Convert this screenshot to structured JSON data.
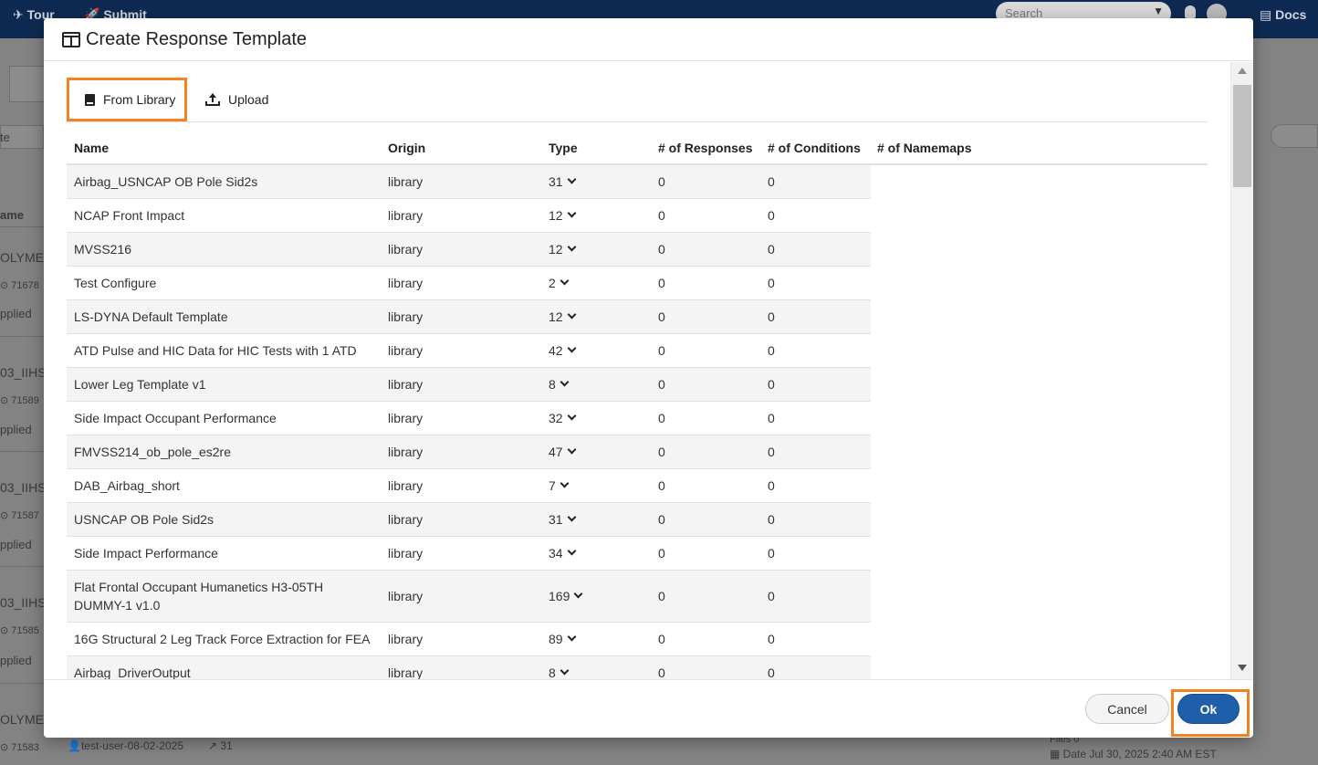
{
  "background": {
    "nav": [
      {
        "label": "Tour"
      },
      {
        "label": "Submit"
      }
    ],
    "search_placeholder": "Search",
    "docs_label": "Docs",
    "left_fragments": {
      "name_header": "ame",
      "row_a_title": "OLYME",
      "row_a_id": "71678",
      "row_a_status": "pplied",
      "row_b_title": "03_IIHS",
      "row_b_id": "71589",
      "row_b_status": "pplied",
      "row_c_title": "03_IIHS",
      "row_c_id": "71587",
      "row_c_status": "pplied",
      "row_d_title": "03_IIHS",
      "row_d_id": "71585",
      "row_d_status": "pplied",
      "row_e_title": "OLYME",
      "row_e_id": "71583",
      "row_e_user": "test-user-08-02-2025",
      "row_e_count": "31",
      "filter_fragment": "te"
    },
    "right_fragments": {
      "files": "Files 0",
      "date": "Date Jul 30, 2025 2:40 AM EST"
    }
  },
  "modal": {
    "title": "Create Response Template",
    "tabs": [
      {
        "label": "From Library",
        "icon": "book-icon",
        "active": true
      },
      {
        "label": "Upload",
        "icon": "upload-icon",
        "active": false
      }
    ],
    "columns": [
      "Name",
      "Origin",
      "Type",
      "# of Responses",
      "# of Conditions",
      "# of Namemaps"
    ],
    "rows": [
      {
        "name": "Airbag_USNCAP OB Pole Sid2s",
        "origin": "library",
        "type": "31",
        "responses": "0",
        "conditions": "0"
      },
      {
        "name": "NCAP Front Impact",
        "origin": "library",
        "type": "12",
        "responses": "0",
        "conditions": "0"
      },
      {
        "name": "MVSS216",
        "origin": "library",
        "type": "12",
        "responses": "0",
        "conditions": "0"
      },
      {
        "name": "Test Configure",
        "origin": "library",
        "type": "2",
        "responses": "0",
        "conditions": "0"
      },
      {
        "name": "LS-DYNA Default Template",
        "origin": "library",
        "type": "12",
        "responses": "0",
        "conditions": "0"
      },
      {
        "name": "ATD Pulse and HIC Data for HIC Tests with 1 ATD",
        "origin": "library",
        "type": "42",
        "responses": "0",
        "conditions": "0"
      },
      {
        "name": "Lower Leg Template v1",
        "origin": "library",
        "type": "8",
        "responses": "0",
        "conditions": "0"
      },
      {
        "name": "Side Impact Occupant Performance",
        "origin": "library",
        "type": "32",
        "responses": "0",
        "conditions": "0"
      },
      {
        "name": "FMVSS214_ob_pole_es2re",
        "origin": "library",
        "type": "47",
        "responses": "0",
        "conditions": "0"
      },
      {
        "name": "DAB_Airbag_short",
        "origin": "library",
        "type": "7",
        "responses": "0",
        "conditions": "0"
      },
      {
        "name": "USNCAP OB Pole Sid2s",
        "origin": "library",
        "type": "31",
        "responses": "0",
        "conditions": "0"
      },
      {
        "name": "Side Impact Performance",
        "origin": "library",
        "type": "34",
        "responses": "0",
        "conditions": "0"
      },
      {
        "name": "Flat Frontal Occupant Humanetics H3-05TH DUMMY-1 v1.0",
        "origin": "library",
        "type": "169",
        "responses": "0",
        "conditions": "0",
        "tall": true
      },
      {
        "name": "16G Structural 2 Leg Track Force Extraction for FEA",
        "origin": "library",
        "type": "89",
        "responses": "0",
        "conditions": "0"
      },
      {
        "name": "Airbag_DriverOutput",
        "origin": "library",
        "type": "8",
        "responses": "0",
        "conditions": "0"
      }
    ],
    "cancel_label": "Cancel",
    "ok_label": "Ok"
  },
  "colors": {
    "highlight": "#f58220",
    "primary": "#1f5ea8",
    "topbar": "#0e2a52"
  }
}
